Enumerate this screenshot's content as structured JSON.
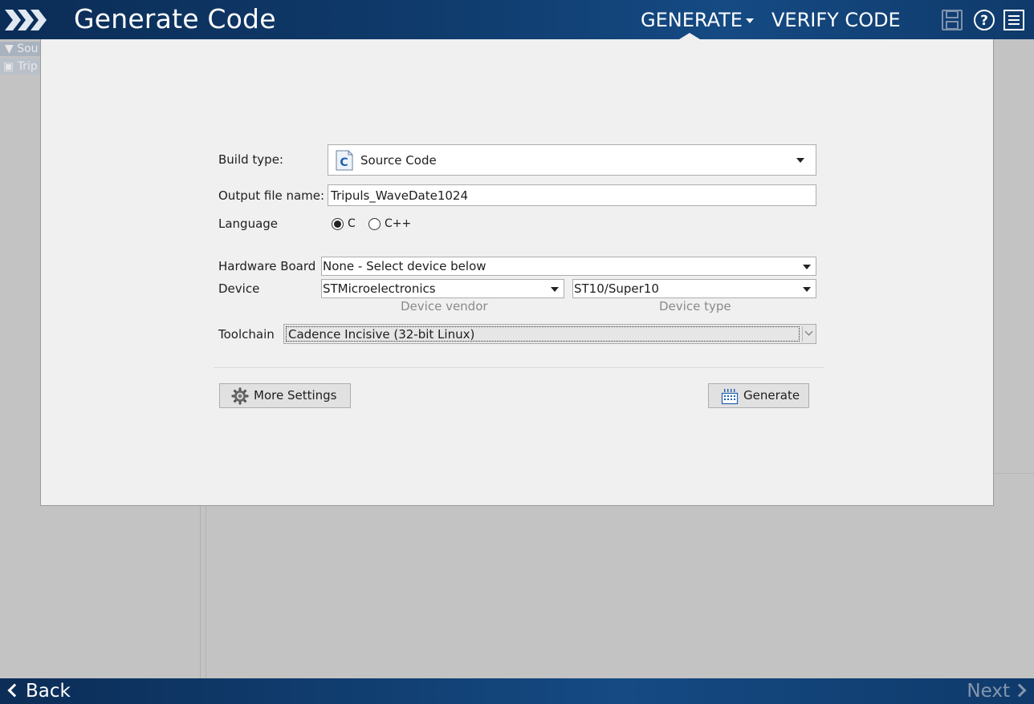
{
  "header": {
    "title": "Generate Code",
    "nav": {
      "generate_label": "GENERATE",
      "verify_label": "VERIFY CODE"
    },
    "icons": [
      "save-icon",
      "help-icon",
      "menu-icon"
    ]
  },
  "background": {
    "tree_row1": "Sou",
    "tree_row2": "Trip"
  },
  "form": {
    "build_type_label": "Build type:",
    "build_type_value": "Source Code",
    "output_label": "Output file name:",
    "output_value": "Tripuls_WaveDate1024",
    "language_label": "Language",
    "language_options": [
      "C",
      "C++"
    ],
    "language_selected": "C",
    "hardware_label": "Hardware Board",
    "hardware_value": "None - Select device below",
    "device_label": "Device",
    "device_vendor_value": "STMicroelectronics",
    "device_type_value": "ST10/Super10",
    "device_vendor_caption": "Device vendor",
    "device_type_caption": "Device type",
    "toolchain_label": "Toolchain",
    "toolchain_value": "Cadence Incisive (32-bit Linux)"
  },
  "buttons": {
    "more_settings": "More Settings",
    "generate": "Generate"
  },
  "footer": {
    "back_label": "Back",
    "next_label": "Next"
  },
  "colors": {
    "header_bg": "#0f3a6b",
    "dialog_bg": "#f0f0f0",
    "next_disabled": "#8496ad"
  }
}
